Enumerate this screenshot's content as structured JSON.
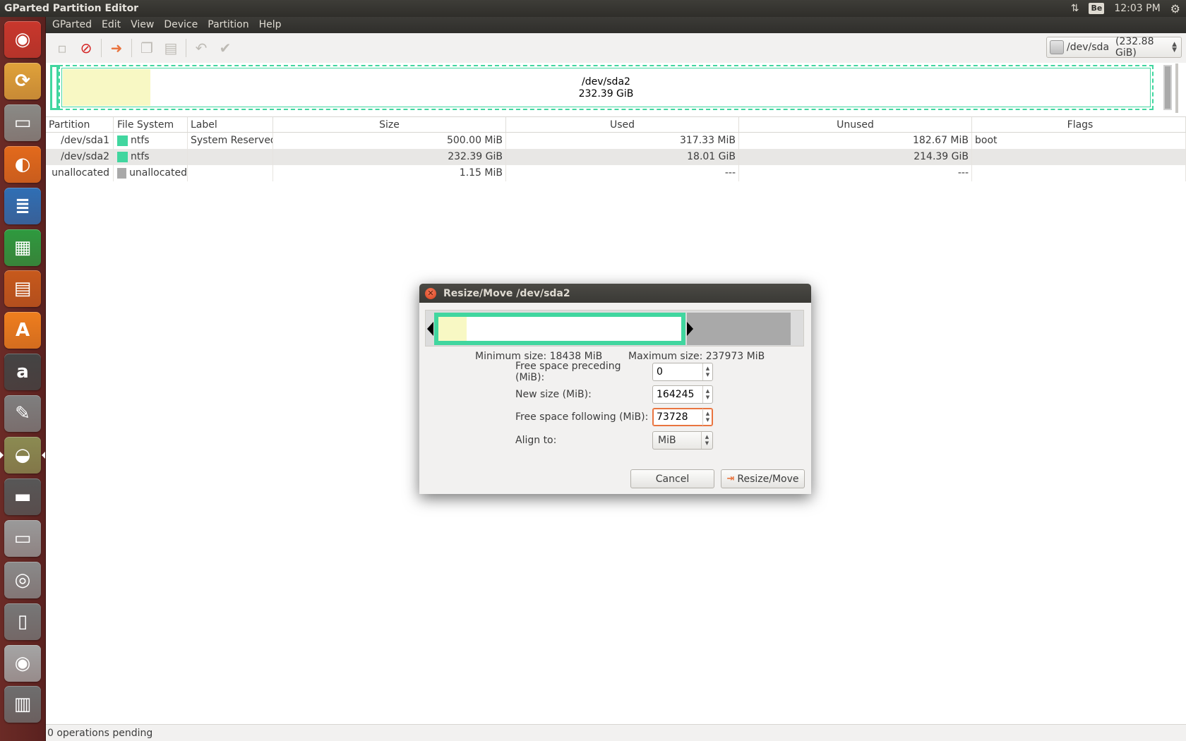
{
  "top_panel": {
    "title": "GParted Partition Editor",
    "keyboard_indicator": "Be",
    "clock": "12:03 PM",
    "network_icon": "network-updown-icon",
    "settings_icon": "gear-icon"
  },
  "launcher": {
    "items": [
      {
        "name": "ubuntu-dash",
        "glyph": "◉",
        "color": "#c9372c"
      },
      {
        "name": "system-updater",
        "glyph": "⟳",
        "color": "#e0a23a"
      },
      {
        "name": "files",
        "glyph": "▭",
        "color": "#8a8a86"
      },
      {
        "name": "firefox",
        "glyph": "◐",
        "color": "#e36a1c"
      },
      {
        "name": "libreoffice-writer",
        "glyph": "≣",
        "color": "#2f6fb5"
      },
      {
        "name": "libreoffice-calc",
        "glyph": "▦",
        "color": "#2e9a3f"
      },
      {
        "name": "libreoffice-impress",
        "glyph": "▤",
        "color": "#c7591c"
      },
      {
        "name": "software-center",
        "glyph": "A",
        "color": "#ef7e1e"
      },
      {
        "name": "amazon",
        "glyph": "a",
        "color": "#444444"
      },
      {
        "name": "system-settings",
        "glyph": "✎",
        "color": "#7f7f7f"
      },
      {
        "name": "gparted",
        "glyph": "◒",
        "color": "#8b8b52"
      },
      {
        "name": "floppy",
        "glyph": "▬",
        "color": "#575757"
      },
      {
        "name": "removable-drive",
        "glyph": "▭",
        "color": "#9a9a9a"
      },
      {
        "name": "hard-drive",
        "glyph": "◎",
        "color": "#8a8a8a"
      },
      {
        "name": "media-player",
        "glyph": "▯",
        "color": "#777777"
      },
      {
        "name": "dvd-drive",
        "glyph": "◉",
        "color": "#a5a5a5"
      },
      {
        "name": "trash",
        "glyph": "▥",
        "color": "#6e6e6e"
      }
    ]
  },
  "menubar": [
    "GParted",
    "Edit",
    "View",
    "Device",
    "Partition",
    "Help"
  ],
  "device_selector": {
    "device": "/dev/sda",
    "size": "(232.88 GiB)"
  },
  "disk_map": {
    "partition": "/dev/sda2",
    "size": "232.39 GiB"
  },
  "table": {
    "headers": [
      "Partition",
      "File System",
      "Label",
      "Size",
      "Used",
      "Unused",
      "Flags"
    ],
    "rows": [
      {
        "partition": "/dev/sda1",
        "fs": "ntfs",
        "fs_color": "#41d69f",
        "label": "System Reserved",
        "size": "500.00 MiB",
        "used": "317.33 MiB",
        "unused": "182.67 MiB",
        "flags": "boot"
      },
      {
        "partition": "/dev/sda2",
        "fs": "ntfs",
        "fs_color": "#41d69f",
        "label": "",
        "size": "232.39 GiB",
        "used": "18.01 GiB",
        "unused": "214.39 GiB",
        "flags": ""
      },
      {
        "partition": "unallocated",
        "fs": "unallocated",
        "fs_color": "#a9a9a9",
        "label": "",
        "size": "1.15 MiB",
        "used": "---",
        "unused": "---",
        "flags": ""
      }
    ]
  },
  "status": "0 operations pending",
  "dialog": {
    "title": "Resize/Move /dev/sda2",
    "min_size": "Minimum size: 18438 MiB",
    "max_size": "Maximum size: 237973 MiB",
    "fields": {
      "preceding_label": "Free space preceding (MiB):",
      "preceding_value": "0",
      "new_size_label": "New size (MiB):",
      "new_size_value": "164245",
      "following_label": "Free space following (MiB):",
      "following_value": "73728",
      "align_label": "Align to:",
      "align_value": "MiB"
    },
    "cancel": "Cancel",
    "resize": "Resize/Move"
  }
}
